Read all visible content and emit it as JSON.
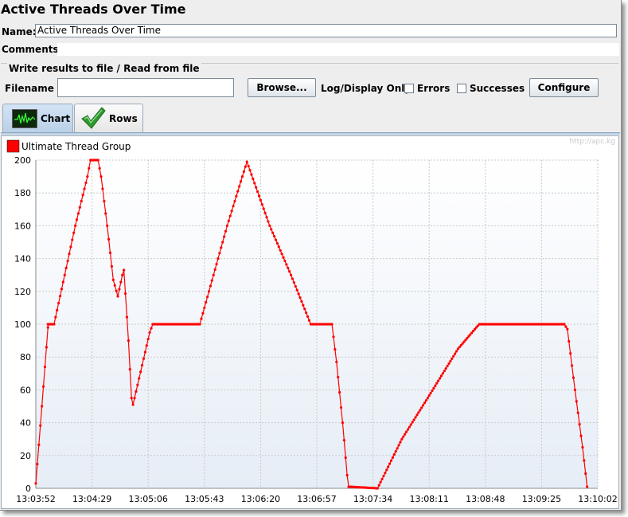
{
  "window": {
    "title": "Active Threads Over Time"
  },
  "form": {
    "name_label": "Name:",
    "name_value": "Active Threads Over Time",
    "comments_label": "Comments:"
  },
  "file_section": {
    "title": "Write results to file / Read from file",
    "filename_label": "Filename",
    "filename_value": "",
    "browse_label": "Browse...",
    "log_display_label": "Log/Display Only:",
    "errors_label": "Errors",
    "errors_checked": false,
    "successes_label": "Successes",
    "successes_checked": false,
    "configure_label": "Configure"
  },
  "tabs": [
    {
      "label": "Chart",
      "icon": "chart-icon",
      "active": true
    },
    {
      "label": "Rows",
      "icon": "checkmark-icon",
      "active": false
    }
  ],
  "watermark": "http://apc.kg",
  "chart_data": {
    "type": "line",
    "title": "",
    "xlabel": "",
    "ylabel": "",
    "ylim": [
      0,
      200
    ],
    "yticks": [
      0,
      20,
      40,
      60,
      80,
      100,
      120,
      140,
      160,
      180,
      200
    ],
    "xticks": [
      "13:03:52",
      "13:04:29",
      "13:05:06",
      "13:05:43",
      "13:06:20",
      "13:06:57",
      "13:07:34",
      "13:08:11",
      "13:08:48",
      "13:09:25",
      "13:10:02"
    ],
    "xlim": [
      "13:03:52",
      "13:10:02"
    ],
    "grid": true,
    "legend": "top-left",
    "series_color": "#ff0000",
    "series": [
      {
        "name": "Ultimate Thread Group",
        "points": [
          [
            "13:03:52",
            3
          ],
          [
            "13:03:56",
            50
          ],
          [
            "13:04:00",
            98
          ],
          [
            "13:04:00",
            100
          ],
          [
            "13:04:04",
            100
          ],
          [
            "13:04:18",
            160
          ],
          [
            "13:04:26",
            190
          ],
          [
            "13:04:28",
            200
          ],
          [
            "13:04:33",
            200
          ],
          [
            "13:04:35",
            190
          ],
          [
            "13:04:39",
            160
          ],
          [
            "13:04:43",
            127
          ],
          [
            "13:04:46",
            117
          ],
          [
            "13:04:49",
            130
          ],
          [
            "13:04:50",
            133
          ],
          [
            "13:04:53",
            90
          ],
          [
            "13:04:55",
            55
          ],
          [
            "13:04:56",
            51
          ],
          [
            "13:05:02",
            75
          ],
          [
            "13:05:07",
            95
          ],
          [
            "13:05:09",
            100
          ],
          [
            "13:05:40",
            100
          ],
          [
            "13:05:58",
            160
          ],
          [
            "13:06:09",
            193
          ],
          [
            "13:06:11",
            199
          ],
          [
            "13:06:26",
            160
          ],
          [
            "13:06:40",
            130
          ],
          [
            "13:06:50",
            107
          ],
          [
            "13:06:53",
            100
          ],
          [
            "13:07:07",
            100
          ],
          [
            "13:07:10",
            77
          ],
          [
            "13:07:14",
            40
          ],
          [
            "13:07:17",
            8
          ],
          [
            "13:07:18",
            1
          ],
          [
            "13:07:37",
            0
          ],
          [
            "13:07:53",
            30
          ],
          [
            "13:08:10",
            55
          ],
          [
            "13:08:30",
            85
          ],
          [
            "13:08:42",
            98
          ],
          [
            "13:08:44",
            100
          ],
          [
            "13:09:40",
            100
          ],
          [
            "13:09:42",
            97
          ],
          [
            "13:09:47",
            60
          ],
          [
            "13:09:52",
            25
          ],
          [
            "13:09:55",
            1
          ]
        ]
      }
    ]
  }
}
